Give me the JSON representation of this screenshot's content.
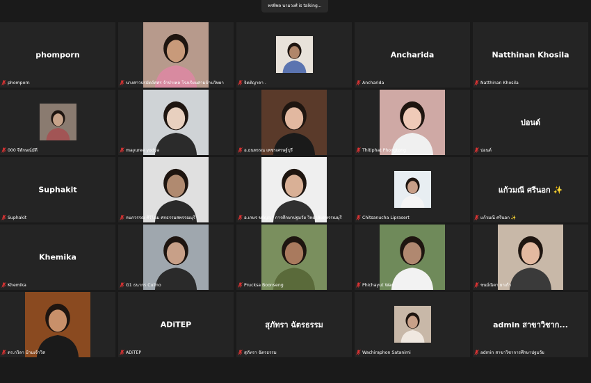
{
  "talking_indicator": "พรทิพล นามวงศ์ is talking...",
  "tiles": [
    {
      "label": "phomporn",
      "display": "phomporn",
      "type": "name"
    },
    {
      "label": "นางสาวปรมัตถ์ศศร จ้าบำเพล โรงเรียนศามบ้านวิทยา",
      "type": "video",
      "bg": "#b79a8c",
      "skin": "#c89a7a",
      "shirt": "#d88aa0"
    },
    {
      "label": "จิตติญาดา .",
      "type": "thumb",
      "bg": "#e8e2da",
      "skin": "#b0866a",
      "shirt": "#5b74b0"
    },
    {
      "label": "Ancharida",
      "display": "Ancharida",
      "type": "name"
    },
    {
      "label": "Natthinan Khosila",
      "display": "Natthinan Khosila",
      "type": "name"
    },
    {
      "label": "000 จีลักษณ์มัดี",
      "type": "thumb",
      "bg": "#8a7b70",
      "skin": "#c7a38a",
      "shirt": "#a25555"
    },
    {
      "label": "mayuree yodya",
      "type": "video",
      "bg": "#cfd3d6",
      "skin": "#e8d0bf",
      "shirt": "#2b2b2b"
    },
    {
      "label": "อ.ธนพรรณ เพชรเศรษฐ์บุรี",
      "type": "video",
      "bg": "#5a3a2a",
      "skin": "#e2b8a0",
      "shirt": "#1a1a1a"
    },
    {
      "label": "Thitiphat Phongtong",
      "type": "video",
      "bg": "#cfa9a5",
      "skin": "#efcab8",
      "shirt": "#f0f0f0"
    },
    {
      "label": "ปอนด์",
      "display": "ปอนด์",
      "type": "name"
    },
    {
      "label": "Suphakit",
      "display": "Suphakit",
      "type": "name"
    },
    {
      "label": "กนกวรรณ ศิริโฉม ศกธรรมสพรรณบุรี",
      "type": "video",
      "bg": "#e0e0e0",
      "skin": "#b08a70",
      "shirt": "#2a2a2a"
    },
    {
      "label": "อ.เกษร ขจัญญา การศึกษาปฐมวัย วิทยาลัยสุพรรณบุรี",
      "type": "video",
      "bg": "#efefef",
      "skin": "#d9b096",
      "shirt": "#303030"
    },
    {
      "label": "Chitsanucha Liprasert",
      "type": "thumb",
      "bg": "#e8eef2",
      "skin": "#c89f88",
      "shirt": "#f4f4f4"
    },
    {
      "label": "แก้วมณี ศรีนอก ✨",
      "display": "แก้วมณี ศรีนอก ✨",
      "type": "name"
    },
    {
      "label": "Khemika",
      "display": "Khemika",
      "type": "name"
    },
    {
      "label": "G1 ธนากร Culino",
      "type": "video",
      "bg": "#9fa7ae",
      "skin": "#c8a088",
      "shirt": "#2a2a2a"
    },
    {
      "label": "Prucksa Boonseng",
      "type": "video",
      "bg": "#7a8f5e",
      "skin": "#a97a5e",
      "shirt": "#5a6a3a"
    },
    {
      "label": "Phichayut Wan",
      "type": "video",
      "bg": "#6f8a5a",
      "skin": "#b08870",
      "shirt": "#f2f2f2"
    },
    {
      "label": "ชนม์ณิตา ยาเก้า",
      "type": "video",
      "bg": "#c8b8a8",
      "skin": "#e3b9a0",
      "shirt": "#3a3a3a"
    },
    {
      "label": "ดร.กวิลา บ้านเจ้าวิส",
      "type": "video",
      "bg": "#8a4a20",
      "skin": "#c8906a",
      "shirt": "#1a1a1a"
    },
    {
      "label": "ADiTEP",
      "display": "ADiTEP",
      "type": "name"
    },
    {
      "label": "สุภัทรา ฉัตรธรรม",
      "display": "สุภัทรา ฉัตรธรรม",
      "type": "name"
    },
    {
      "label": "Wachiraphon Satanimi",
      "type": "thumb",
      "bg": "#c8b8a8",
      "skin": "#c8a088",
      "shirt": "#f0e8e0"
    },
    {
      "label": "admin สาขาวิชาการศึกษาปฐมวัย",
      "display": "admin สาขาวิชาก...",
      "type": "name"
    }
  ]
}
